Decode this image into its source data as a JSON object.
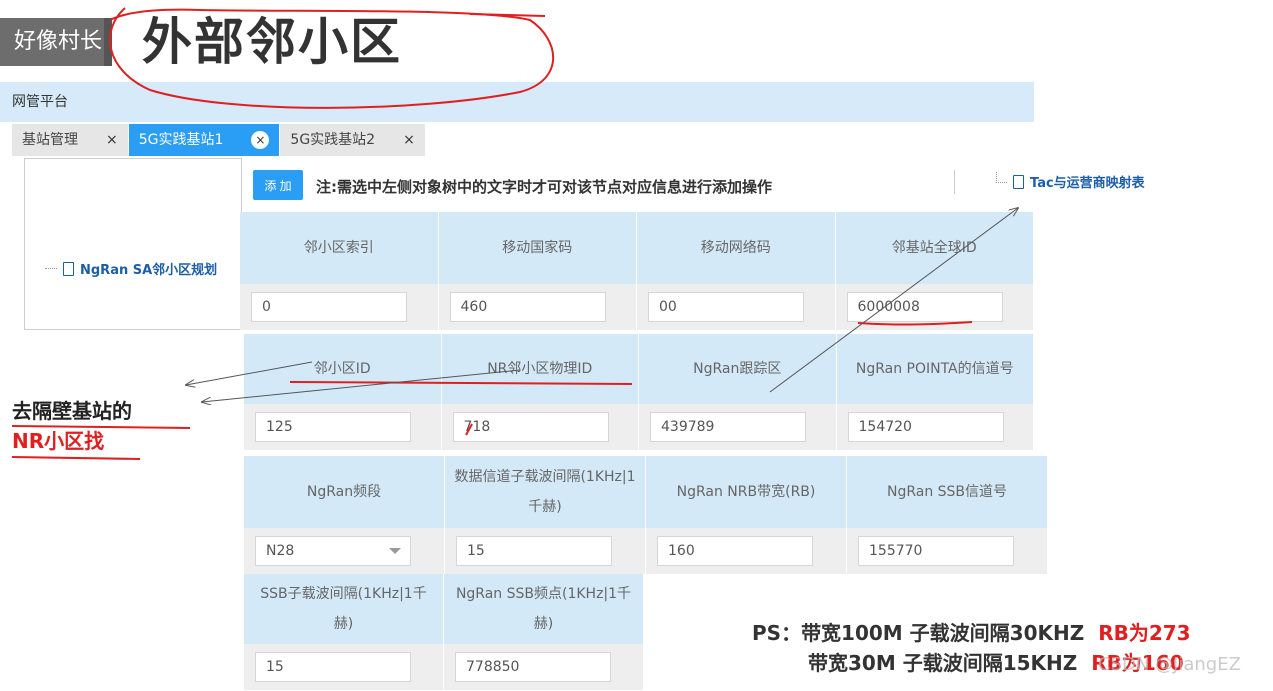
{
  "video": {
    "channel_badge": "好像村长",
    "title": "外部邻小区"
  },
  "app": {
    "header_title": "网管平台",
    "tabs": [
      {
        "label": "基站管理",
        "close": "×",
        "active": false
      },
      {
        "label": "5G实践基站1",
        "close": "×",
        "active": true
      },
      {
        "label": "5G实践基站2",
        "close": "×",
        "active": false
      }
    ],
    "tree": {
      "node_label": "NgRan SA邻小区规划"
    },
    "toolbar": {
      "add_label": "添 加",
      "notice": "注:需选中左侧对象树中的文字时才可对该节点对应信息进行添加操作",
      "tac_link": "Tac与运营商映射表"
    }
  },
  "form": {
    "group1": {
      "headers": [
        "邻小区索引",
        "移动国家码",
        "移动网络码",
        "邻基站全球ID"
      ],
      "values": [
        "0",
        "460",
        "00",
        "6000008"
      ]
    },
    "group2": {
      "headers": [
        "邻小区ID",
        "NR邻小区物理ID",
        "NgRan跟踪区",
        "NgRan POINTA的信道号"
      ],
      "values": [
        "125",
        "718",
        "439789",
        "154720"
      ]
    },
    "group3": {
      "headers": [
        "NgRan频段",
        "数据信道子载波间隔(1KHz|1千赫)",
        "NgRan NRB带宽(RB)",
        "NgRan SSB信道号"
      ],
      "band_selected": "N28",
      "values": [
        "15",
        "160",
        "155770"
      ]
    },
    "group4": {
      "headers": [
        "SSB子载波间隔(1KHz|1千赫)",
        "NgRan SSB频点(1KHz|1千赫)"
      ],
      "values": [
        "15",
        "778850"
      ]
    }
  },
  "annotations": {
    "side_line1": "去隔壁基站的",
    "side_line2": "NR小区找",
    "ps_prefix": "PS：",
    "ps_line1_text": "带宽100M 子载波间隔30KHZ",
    "ps_line1_red": "RB为273",
    "ps_line2_text": "带宽30M 子载波间隔15KHZ",
    "ps_line2_red": "RB为160",
    "watermark": "CSDN @JiangEZ",
    "ink_color": "#e02020"
  }
}
